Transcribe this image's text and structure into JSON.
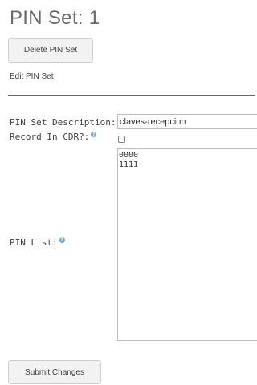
{
  "page": {
    "title": "PIN Set: 1",
    "delete_button_label": "Delete PIN Set",
    "edit_link_label": "Edit PIN Set"
  },
  "form": {
    "description_label": "PIN Set Description:",
    "description_value": "claves-recepcion",
    "record_cdr_label": "Record In CDR?:",
    "record_cdr_checked": false,
    "pin_list_label": "PIN List:",
    "pin_list_value": "0000\n1111",
    "submit_label": "Submit Changes"
  },
  "icons": {
    "help": "help-icon",
    "help_color": "#6aa8dc"
  }
}
